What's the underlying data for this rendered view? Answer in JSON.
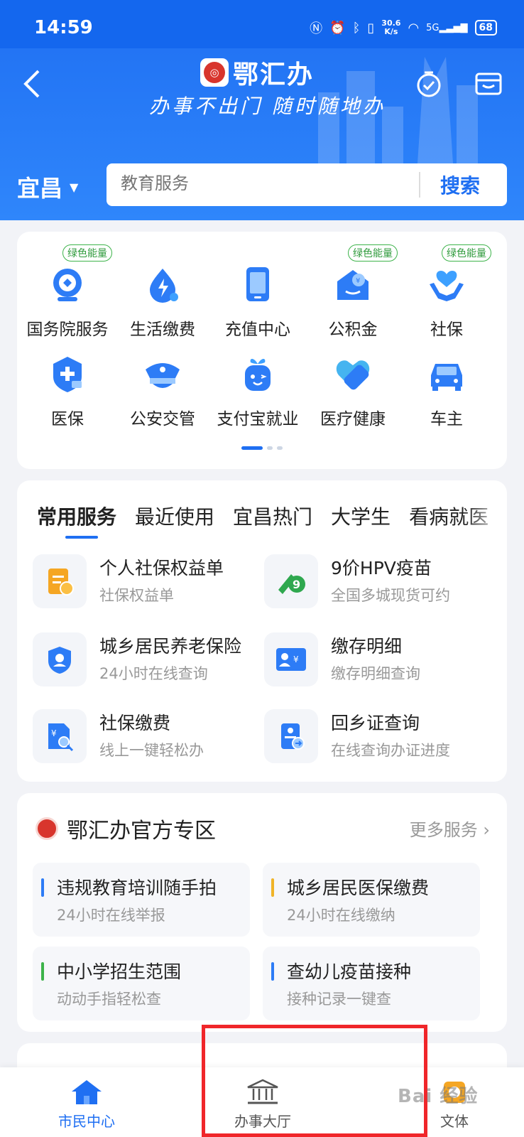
{
  "status_bar": {
    "time": "14:59",
    "net_speed_value": "30.6",
    "net_speed_unit": "K/s",
    "signal": "5G",
    "battery": "68"
  },
  "header": {
    "app_name": "鄂汇办",
    "slogan": "办事不出门 随时随地办",
    "city": "宜昌",
    "search_placeholder": "教育服务",
    "search_button": "搜索"
  },
  "quick_grid": {
    "tag_label": "绿色能量",
    "items": [
      {
        "label": "国务院服务",
        "tag": true,
        "color": "#2d7cf6"
      },
      {
        "label": "生活缴费",
        "tag": false,
        "color": "#2d7cf6"
      },
      {
        "label": "充值中心",
        "tag": false,
        "color": "#2d7cf6"
      },
      {
        "label": "公积金",
        "tag": true,
        "color": "#2d7cf6"
      },
      {
        "label": "社保",
        "tag": true,
        "color": "#2d7cf6"
      },
      {
        "label": "医保",
        "tag": false,
        "color": "#2d7cf6"
      },
      {
        "label": "公安交管",
        "tag": false,
        "color": "#2d7cf6"
      },
      {
        "label": "支付宝就业",
        "tag": false,
        "color": "#2d7cf6"
      },
      {
        "label": "医疗健康",
        "tag": false,
        "color": "#2d7cf6"
      },
      {
        "label": "车主",
        "tag": false,
        "color": "#2d7cf6"
      }
    ]
  },
  "services": {
    "tabs": [
      "常用服务",
      "最近使用",
      "宜昌热门",
      "大学生",
      "看病就医"
    ],
    "items": [
      {
        "title": "个人社保权益单",
        "subtitle": "社保权益单"
      },
      {
        "title": "9价HPV疫苗",
        "subtitle": "全国多城现货可约"
      },
      {
        "title": "城乡居民养老保险",
        "subtitle": "24小时在线查询"
      },
      {
        "title": "缴存明细",
        "subtitle": "缴存明细查询"
      },
      {
        "title": "社保缴费",
        "subtitle": "线上一键轻松办"
      },
      {
        "title": "回乡证查询",
        "subtitle": "在线查询办证进度"
      }
    ]
  },
  "official": {
    "title": "鄂汇办官方专区",
    "more": "更多服务",
    "items": [
      {
        "title": "违规教育培训随手拍",
        "subtitle": "24小时在线举报",
        "bar_color": "#2d7cf6"
      },
      {
        "title": "城乡居民医保缴费",
        "subtitle": "24小时在线缴纳",
        "bar_color": "#f0b428"
      },
      {
        "title": "中小学招生范围",
        "subtitle": "动动手指轻松查",
        "bar_color": "#3db34a"
      },
      {
        "title": "查幼儿疫苗接种",
        "subtitle": "接种记录一键查",
        "bar_color": "#2d7cf6"
      }
    ]
  },
  "bottom_nav": {
    "home": "市民中心",
    "hall": "办事大厅",
    "culture": "文体"
  },
  "watermark": "Bai 经验"
}
